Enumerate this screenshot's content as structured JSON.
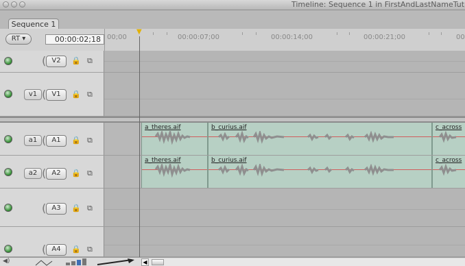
{
  "window": {
    "title": "Timeline: Sequence 1 in FirstAndLastNameTut c"
  },
  "tabs": [
    {
      "label": "Sequence 1"
    }
  ],
  "controls": {
    "rt_label": "RT ▾",
    "timecode": "00:00:02;18"
  },
  "ruler": {
    "labels": [
      "00;00",
      "00:00:07;00",
      "00:00:14;00",
      "00:00:21;00",
      "00"
    ]
  },
  "tracks": {
    "v2": {
      "dest": "V2"
    },
    "v1": {
      "source": "v1",
      "dest": "V1"
    },
    "a1": {
      "source": "a1",
      "dest": "A1"
    },
    "a2": {
      "source": "a2",
      "dest": "A2"
    },
    "a3": {
      "dest": "A3"
    },
    "a4": {
      "dest": "A4"
    }
  },
  "clips": {
    "a1": [
      "a_theres.aif",
      "b_curius.aif",
      "c_across"
    ],
    "a2": [
      "a_theres.aif",
      "b_curius.aif",
      "c_across"
    ]
  },
  "icons": {
    "lock": "🔒",
    "sync": "⧉",
    "visibility": "●",
    "scroll_left": "◀"
  },
  "colors": {
    "audio_clip": "#b7d0c4",
    "waveform": "#8f8f8f",
    "audio_level": "#d05d5d",
    "playhead_marker": "#e2b100"
  }
}
